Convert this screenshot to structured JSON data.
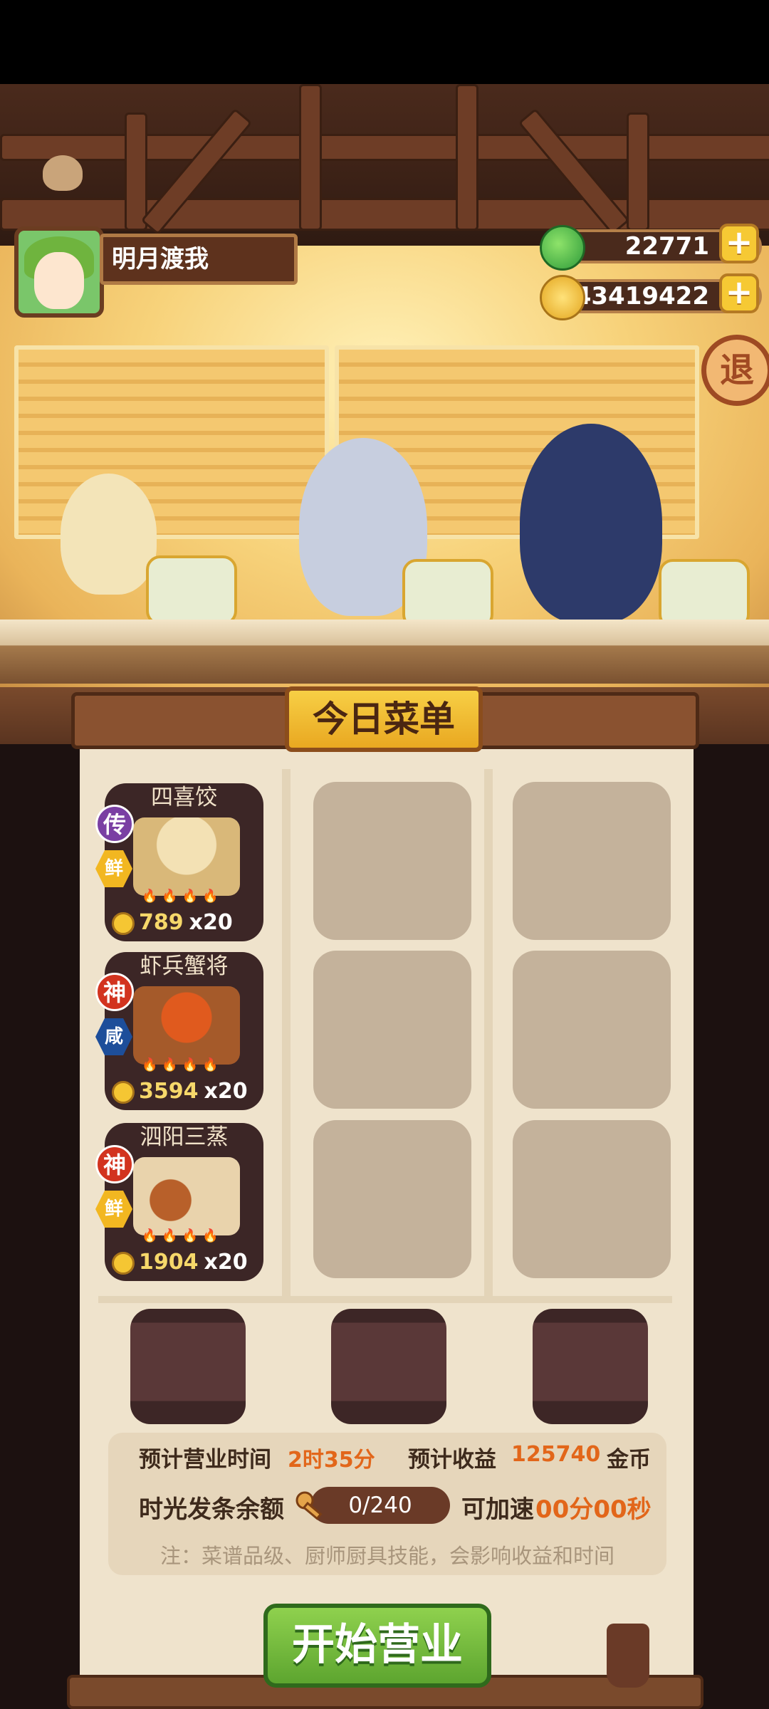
{
  "player": {
    "name": "明月渡我"
  },
  "currency": {
    "jade": "22771",
    "coins": "43419422",
    "plus_label": "+"
  },
  "exit_label": "退",
  "menu": {
    "title": "今日菜单",
    "dishes": [
      {
        "name": "四喜饺",
        "rank": "传",
        "flavor": "鲜",
        "price": "789",
        "count": "x20"
      },
      {
        "name": "虾兵蟹将",
        "rank": "神",
        "flavor": "咸",
        "price": "3594",
        "count": "x20"
      },
      {
        "name": "泗阳三蒸",
        "rank": "神",
        "flavor": "鲜",
        "price": "1904",
        "count": "x20"
      }
    ]
  },
  "info": {
    "time_label": "预计营业时间",
    "time_value": "2时35分",
    "income_label": "预计收益",
    "income_value": "125740",
    "income_unit": "金币",
    "balance_label": "时光发条余额",
    "balance_value": "0/240",
    "speedup_label": "可加速",
    "speedup_value": "00分00秒",
    "note": "注：菜谱品级、厨师厨具技能，会影响收益和时间"
  },
  "start_button": "开始营业",
  "colors": {
    "legend_badge": "#7a3fa3",
    "god_badge": "#d2331f",
    "fresh_badge": "#f2b721",
    "salty_badge": "#1d4e9a",
    "accent_orange": "#e2661a"
  }
}
